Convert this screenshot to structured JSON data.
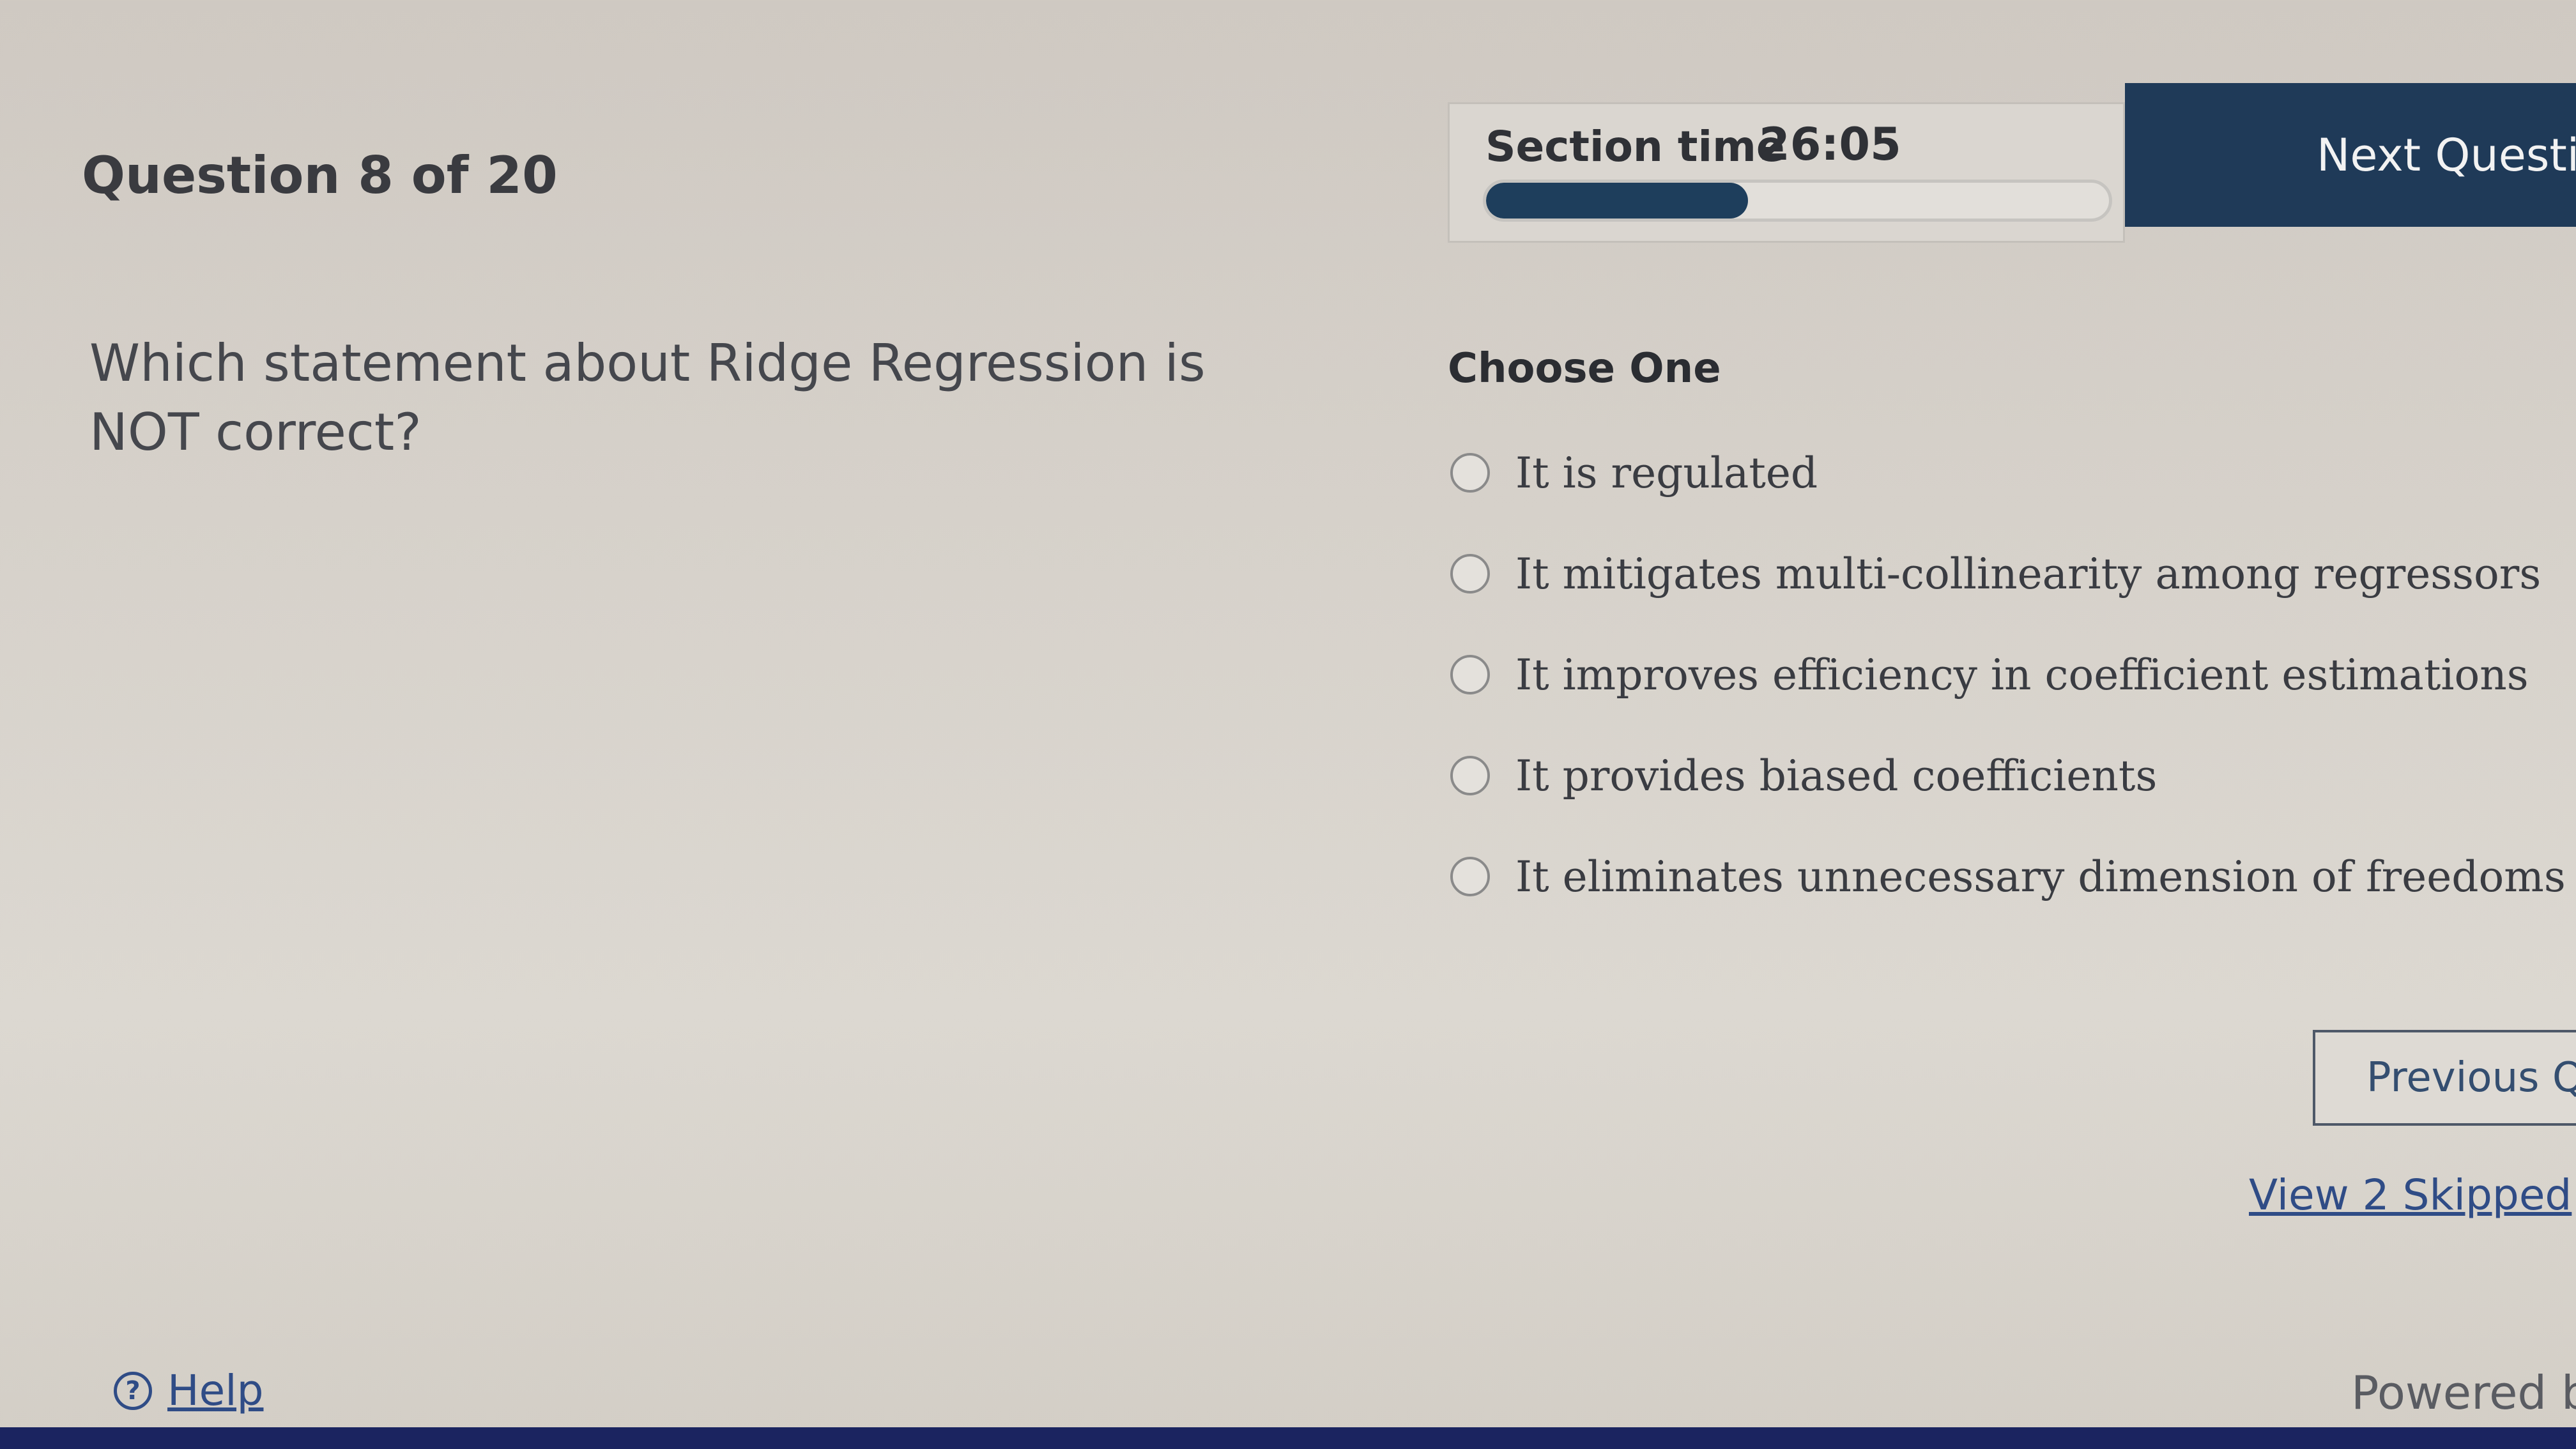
{
  "header": {
    "question_counter": "Question 8 of 20",
    "timer": {
      "label": "Section time",
      "value": "26:05",
      "progress_fraction": 0.42
    },
    "next_button_label": "Next Questio"
  },
  "question": {
    "text": "Which statement about Ridge Regression is NOT correct?",
    "choose_label": "Choose One",
    "options": [
      {
        "label": "It is regulated",
        "selected": false
      },
      {
        "label": "It mitigates multi-collinearity among regressors",
        "selected": false
      },
      {
        "label": "It improves efficiency in coefficient estimations",
        "selected": false
      },
      {
        "label": "It provides biased coefficients",
        "selected": false
      },
      {
        "label": "It eliminates unnecessary dimension of freedoms",
        "selected": false
      }
    ]
  },
  "navigation": {
    "previous_button_label": "Previous Q",
    "skipped_link_label": "View 2 Skipped"
  },
  "footer": {
    "help_icon_glyph": "?",
    "help_label": "Help",
    "powered_text": "Powered b"
  },
  "colors": {
    "accent": "#1f3a58",
    "link": "#2f4c86",
    "background": "#d6d1ca"
  }
}
